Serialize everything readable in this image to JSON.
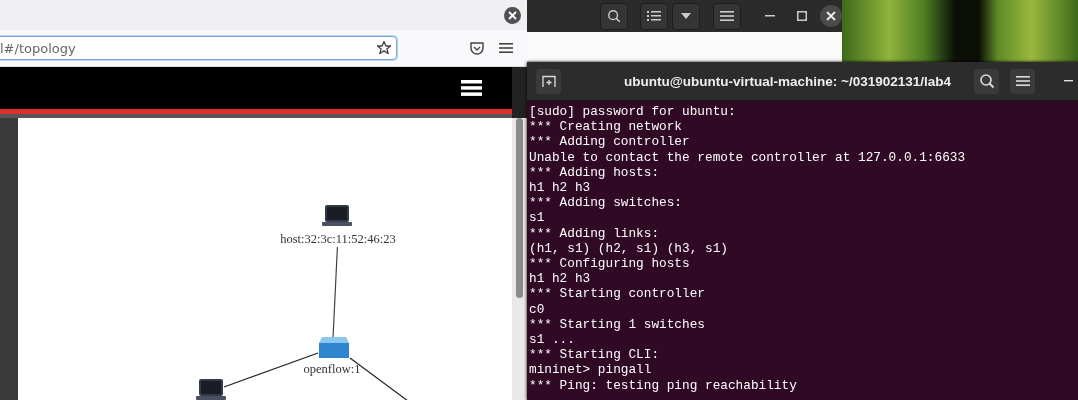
{
  "browser": {
    "url": "l#/topology",
    "topology": {
      "nodes": [
        {
          "kind": "host",
          "label": "host:32:3c:11:52:46:23"
        },
        {
          "kind": "switch",
          "label": "openflow:1"
        },
        {
          "kind": "host"
        }
      ]
    }
  },
  "terminal": {
    "title": "ubuntu@ubuntu-virtual-machine: ~/031902131/lab4",
    "lines": [
      "[sudo] password for ubuntu:",
      "*** Creating network",
      "*** Adding controller",
      "Unable to contact the remote controller at 127.0.0.1:6633",
      "*** Adding hosts:",
      "h1 h2 h3",
      "*** Adding switches:",
      "s1",
      "*** Adding links:",
      "(h1, s1) (h2, s1) (h3, s1)",
      "*** Configuring hosts",
      "h1 h2 h3",
      "*** Starting controller",
      "c0",
      "*** Starting 1 switches",
      "s1 ...",
      "*** Starting CLI:",
      "mininet> pingall",
      "*** Ping: testing ping reachability"
    ]
  }
}
